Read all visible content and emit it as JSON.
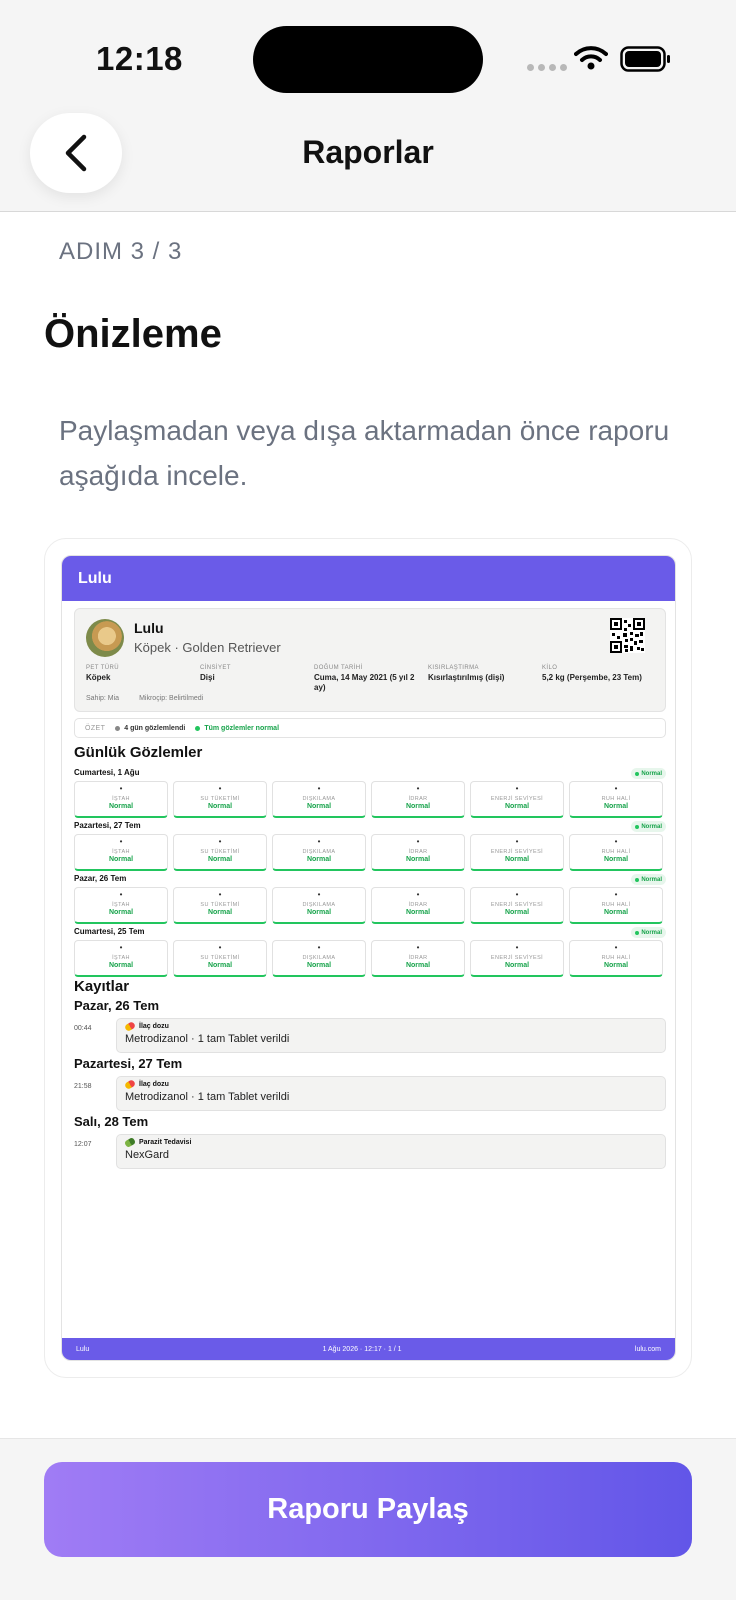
{
  "status_bar": {
    "time": "12:18"
  },
  "nav": {
    "title": "Raporlar"
  },
  "step": "ADIM 3 / 3",
  "heading": "Önizleme",
  "description": "Paylaşmadan veya dışa aktarmadan önce raporu aşağıda incele.",
  "report": {
    "header_title": "Lulu",
    "pet": {
      "name": "Lulu",
      "breed": "Köpek · Golden Retriever",
      "fields": [
        {
          "label": "PET TÜRÜ",
          "value": "Köpek"
        },
        {
          "label": "CİNSİYET",
          "value": "Dişi"
        },
        {
          "label": "DOĞUM TARİHİ",
          "value": "Cuma, 14 May 2021 (5 yıl 2 ay)"
        },
        {
          "label": "KISIRLAŞTIRMA",
          "value": "Kısırlaştırılmış (dişi)"
        },
        {
          "label": "KİLO",
          "value": "5,2 kg (Perşembe, 23 Tem)"
        }
      ],
      "owner": "Sahip: Mia",
      "microchip": "Mikroçip: Belirtilmedi"
    },
    "summary": {
      "label": "ÖZET",
      "observed": "4 gün gözlemlendi",
      "status": "Tüm gözlemler normal"
    },
    "daily_title": "Günlük Gözlemler",
    "days": [
      {
        "title": "Cumartesi, 1 Ağu",
        "badge": "Normal",
        "cards": [
          {
            "dot": "•",
            "label": "İŞTAH",
            "value": "Normal"
          },
          {
            "dot": "•",
            "label": "SU TÜKETİMİ",
            "value": "Normal"
          },
          {
            "dot": "•",
            "label": "DIŞKILAMA",
            "value": "Normal"
          },
          {
            "dot": "•",
            "label": "İDRAR",
            "value": "Normal"
          },
          {
            "dot": "•",
            "label": "ENERJİ SEVİYESİ",
            "value": "Normal"
          },
          {
            "dot": "•",
            "label": "RUH HALİ",
            "value": "Normal"
          }
        ]
      },
      {
        "title": "Pazartesi, 27 Tem",
        "badge": "Normal",
        "cards": [
          {
            "dot": "•",
            "label": "İŞTAH",
            "value": "Normal"
          },
          {
            "dot": "•",
            "label": "SU TÜKETİMİ",
            "value": "Normal"
          },
          {
            "dot": "•",
            "label": "DIŞKILAMA",
            "value": "Normal"
          },
          {
            "dot": "•",
            "label": "İDRAR",
            "value": "Normal"
          },
          {
            "dot": "•",
            "label": "ENERJİ SEVİYESİ",
            "value": "Normal"
          },
          {
            "dot": "•",
            "label": "RUH HALİ",
            "value": "Normal"
          }
        ]
      },
      {
        "title": "Pazar, 26 Tem",
        "badge": "Normal",
        "cards": [
          {
            "dot": "•",
            "label": "İŞTAH",
            "value": "Normal"
          },
          {
            "dot": "•",
            "label": "SU TÜKETİMİ",
            "value": "Normal"
          },
          {
            "dot": "•",
            "label": "DIŞKILAMA",
            "value": "Normal"
          },
          {
            "dot": "•",
            "label": "İDRAR",
            "value": "Normal"
          },
          {
            "dot": "•",
            "label": "ENERJİ SEVİYESİ",
            "value": "Normal"
          },
          {
            "dot": "•",
            "label": "RUH HALİ",
            "value": "Normal"
          }
        ]
      },
      {
        "title": "Cumartesi, 25 Tem",
        "badge": "Normal",
        "cards": [
          {
            "dot": "•",
            "label": "İŞTAH",
            "value": "Normal"
          },
          {
            "dot": "•",
            "label": "SU TÜKETİMİ",
            "value": "Normal"
          },
          {
            "dot": "•",
            "label": "DIŞKILAMA",
            "value": "Normal"
          },
          {
            "dot": "•",
            "label": "İDRAR",
            "value": "Normal"
          },
          {
            "dot": "•",
            "label": "ENERJİ SEVİYESİ",
            "value": "Normal"
          },
          {
            "dot": "•",
            "label": "RUH HALİ",
            "value": "Normal"
          }
        ]
      }
    ],
    "records_title": "Kayıtlar",
    "records": [
      {
        "day": "Pazar, 26 Tem",
        "time": "00:44",
        "type": "İlaç dozu",
        "icon": "pill-icon",
        "desc": "Metrodizanol · 1 tam Tablet verildi"
      },
      {
        "day": "Pazartesi, 27 Tem",
        "time": "21:58",
        "type": "İlaç dozu",
        "icon": "pill-icon",
        "desc": "Metrodizanol · 1 tam Tablet verildi"
      },
      {
        "day": "Salı, 28 Tem",
        "time": "12:07",
        "type": "Parazit Tedavisi",
        "icon": "parasite-icon",
        "desc": "NexGard"
      }
    ],
    "footer": {
      "left": "Lulu",
      "center": "1 Ağu 2026 · 12:17 · 1 / 1",
      "right": "lulu.com"
    }
  },
  "share_button": "Raporu Paylaş",
  "colors": {
    "accent": "#6a5be8",
    "success": "#16a34a",
    "gradient_start": "#a07cf5",
    "gradient_end": "#6256e8"
  }
}
